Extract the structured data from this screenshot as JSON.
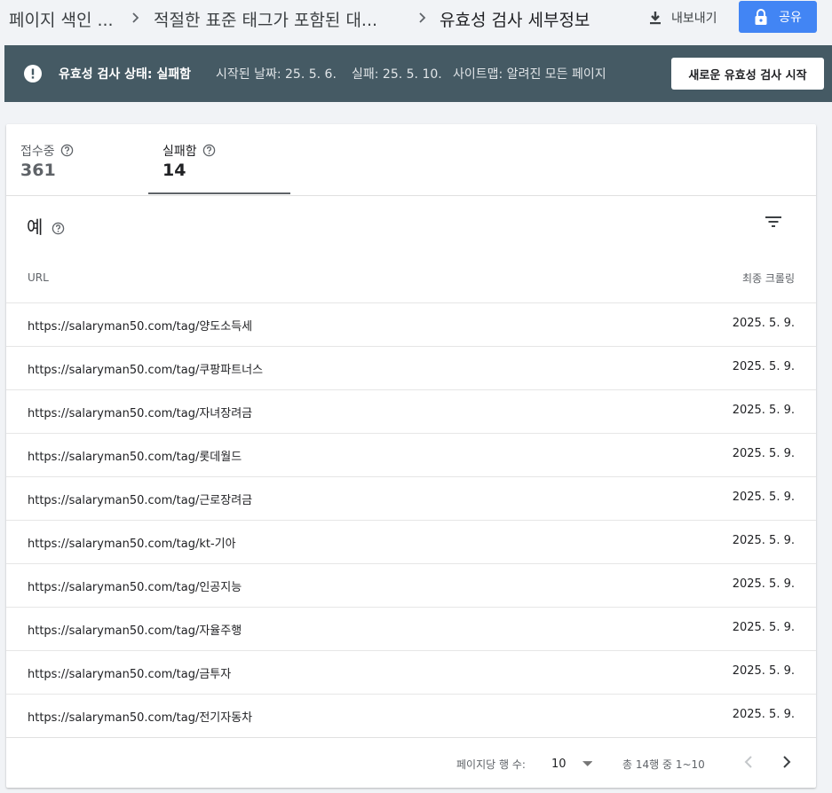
{
  "breadcrumb": {
    "items": [
      "페이지 색인 ...",
      "적절한 표준 태그가 포함된 대...",
      "유효성 검사 세부정보"
    ]
  },
  "actions": {
    "export_label": "내보내기",
    "share_label": "공유"
  },
  "status": {
    "title": "유효성 검사 상태: 실패함",
    "started": "시작된 날짜: 25. 5. 6.",
    "failed": "실패: 25. 5. 10.",
    "sitemap": "사이트맵: 알려진 모든 페이지",
    "restart_label": "새로운 유효성 검사 시작",
    "bar_color": "#455a64"
  },
  "tabs": [
    {
      "label": "접수중",
      "value": "361"
    },
    {
      "label": "실패함",
      "value": "14"
    }
  ],
  "section": {
    "title": "예"
  },
  "table": {
    "columns": {
      "url": "URL",
      "crawl": "최종 크롤링"
    },
    "rows": [
      {
        "url": "https://salaryman50.com/tag/양도소득세",
        "date": "2025. 5. 9."
      },
      {
        "url": "https://salaryman50.com/tag/쿠팡파트너스",
        "date": "2025. 5. 9."
      },
      {
        "url": "https://salaryman50.com/tag/자녀장려금",
        "date": "2025. 5. 9."
      },
      {
        "url": "https://salaryman50.com/tag/롯데월드",
        "date": "2025. 5. 9."
      },
      {
        "url": "https://salaryman50.com/tag/근로장려금",
        "date": "2025. 5. 9."
      },
      {
        "url": "https://salaryman50.com/tag/kt-기아",
        "date": "2025. 5. 9."
      },
      {
        "url": "https://salaryman50.com/tag/인공지능",
        "date": "2025. 5. 9."
      },
      {
        "url": "https://salaryman50.com/tag/자율주행",
        "date": "2025. 5. 9."
      },
      {
        "url": "https://salaryman50.com/tag/금투자",
        "date": "2025. 5. 9."
      },
      {
        "url": "https://salaryman50.com/tag/전기자동차",
        "date": "2025. 5. 9."
      }
    ]
  },
  "pagination": {
    "rows_per_page_label": "페이지당 행 수:",
    "rows_per_page_value": "10",
    "range_label": "총 14행 중 1~10"
  }
}
